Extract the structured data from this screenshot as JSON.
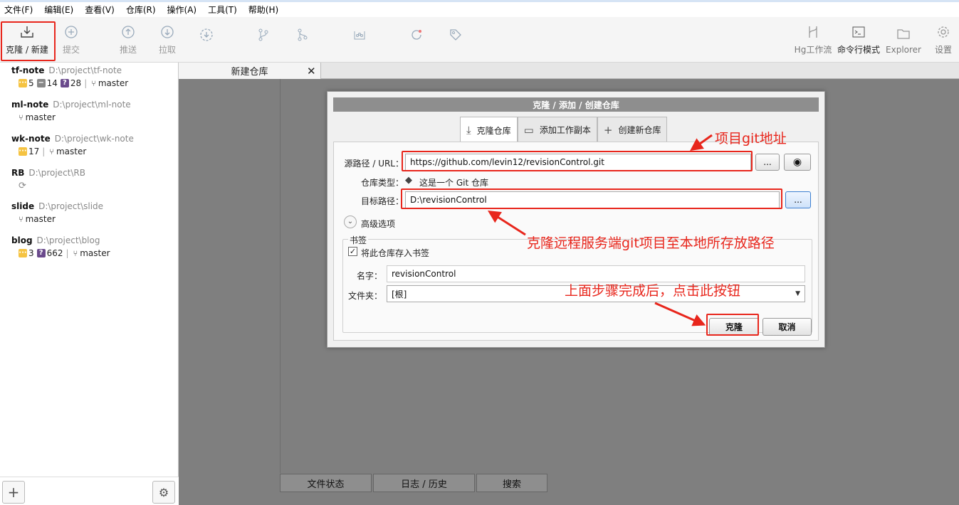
{
  "menubar": [
    "文件(F)",
    "编辑(E)",
    "查看(V)",
    "仓库(R)",
    "操作(A)",
    "工具(T)",
    "帮助(H)"
  ],
  "toolbar": {
    "clone_new": "克隆 / 新建",
    "commit": "提交",
    "push": "推送",
    "pull": "拉取",
    "hg_flow": "Hg工作流",
    "terminal": "命令行模式",
    "explorer": "Explorer",
    "settings": "设置"
  },
  "repos": [
    {
      "name": "tf-note",
      "path": "D:\\project\\tf-note",
      "yellow": "5",
      "grey": "14",
      "purple": "28",
      "branch": "master"
    },
    {
      "name": "ml-note",
      "path": "D:\\project\\ml-note",
      "branch": "master"
    },
    {
      "name": "wk-note",
      "path": "D:\\project\\wk-note",
      "yellow": "17",
      "branch": "master"
    },
    {
      "name": "RB",
      "path": "D:\\project\\RB"
    },
    {
      "name": "slide",
      "path": "D:\\project\\slide",
      "branch": "master"
    },
    {
      "name": "blog",
      "path": "D:\\project\\blog",
      "yellow": "3",
      "purple": "662",
      "branch": "master"
    }
  ],
  "tab": {
    "label": "新建仓库",
    "close": "✕"
  },
  "bottom_tabs": [
    "文件状态",
    "日志 / 历史",
    "搜索"
  ],
  "dialog": {
    "title": "克隆 / 添加 / 创建仓库",
    "tabs": [
      "克隆仓库",
      "添加工作副本",
      "创建新仓库"
    ],
    "source_label": "源路径 / URL：",
    "source_value": "https://github.com/levin12/revisionControl.git",
    "browse": "...",
    "repo_type_label": "仓库类型：",
    "repo_type_value": "这是一个 Git 仓库",
    "dest_label": "目标路径：",
    "dest_value": "D:\\revisionControl",
    "advanced": "高级选项",
    "bookmark_group": "书签",
    "bookmark_check": "将此仓库存入书签",
    "name_label": "名字：",
    "name_value": "revisionControl",
    "folder_label": "文件夹：",
    "folder_value": "[根]",
    "clone_btn": "克隆",
    "cancel_btn": "取消"
  },
  "annotations": {
    "git_address": "项目git地址",
    "local_path": "克隆远程服务端git项目至本地所存放路径",
    "click_button": "上面步骤完成后，点击此按钮"
  },
  "colors": {
    "annotation_red": "#e8261c",
    "badge_yellow": "#f5c342",
    "badge_purple": "#6a4a8c"
  }
}
